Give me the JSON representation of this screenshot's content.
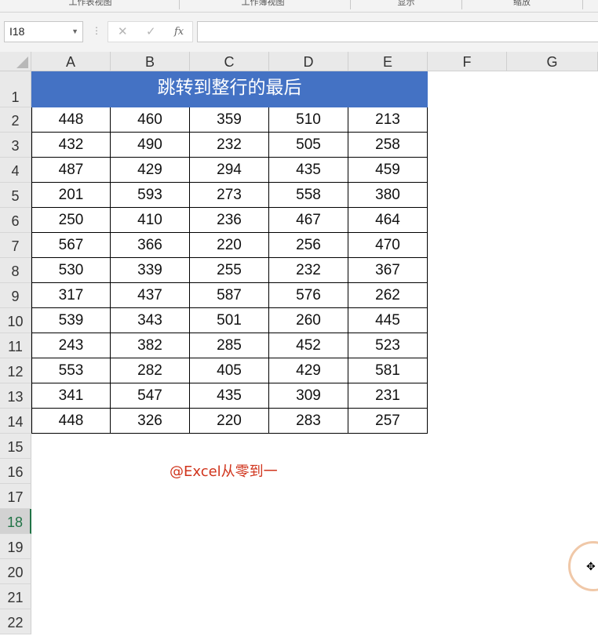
{
  "ribbon": {
    "groups": [
      "工作表视图",
      "工作簿视图",
      "显示",
      "缩放"
    ]
  },
  "formula_bar": {
    "name_box": "I18",
    "cancel_glyph": "✕",
    "enter_glyph": "✓",
    "fx_glyph": "fx",
    "formula": ""
  },
  "sheet": {
    "columns": [
      "A",
      "B",
      "C",
      "D",
      "E",
      "F",
      "G"
    ],
    "rows": [
      "1",
      "2",
      "3",
      "4",
      "5",
      "6",
      "7",
      "8",
      "9",
      "10",
      "11",
      "12",
      "13",
      "14",
      "15",
      "16",
      "17",
      "18",
      "19",
      "20",
      "21",
      "22"
    ],
    "active_row": "18",
    "title": "跳转到整行的最后",
    "data": [
      [
        "448",
        "460",
        "359",
        "510",
        "213"
      ],
      [
        "432",
        "490",
        "232",
        "505",
        "258"
      ],
      [
        "487",
        "429",
        "294",
        "435",
        "459"
      ],
      [
        "201",
        "593",
        "273",
        "558",
        "380"
      ],
      [
        "250",
        "410",
        "236",
        "467",
        "464"
      ],
      [
        "567",
        "366",
        "220",
        "256",
        "470"
      ],
      [
        "530",
        "339",
        "255",
        "232",
        "367"
      ],
      [
        "317",
        "437",
        "587",
        "576",
        "262"
      ],
      [
        "539",
        "343",
        "501",
        "260",
        "445"
      ],
      [
        "243",
        "382",
        "285",
        "452",
        "523"
      ],
      [
        "553",
        "282",
        "405",
        "429",
        "581"
      ],
      [
        "341",
        "547",
        "435",
        "309",
        "231"
      ],
      [
        "448",
        "326",
        "220",
        "283",
        "257"
      ]
    ],
    "watermark": "@Excel从零到一"
  },
  "colors": {
    "title_fill": "#4472c4",
    "watermark": "#d0341c",
    "active_header": "#217346"
  }
}
